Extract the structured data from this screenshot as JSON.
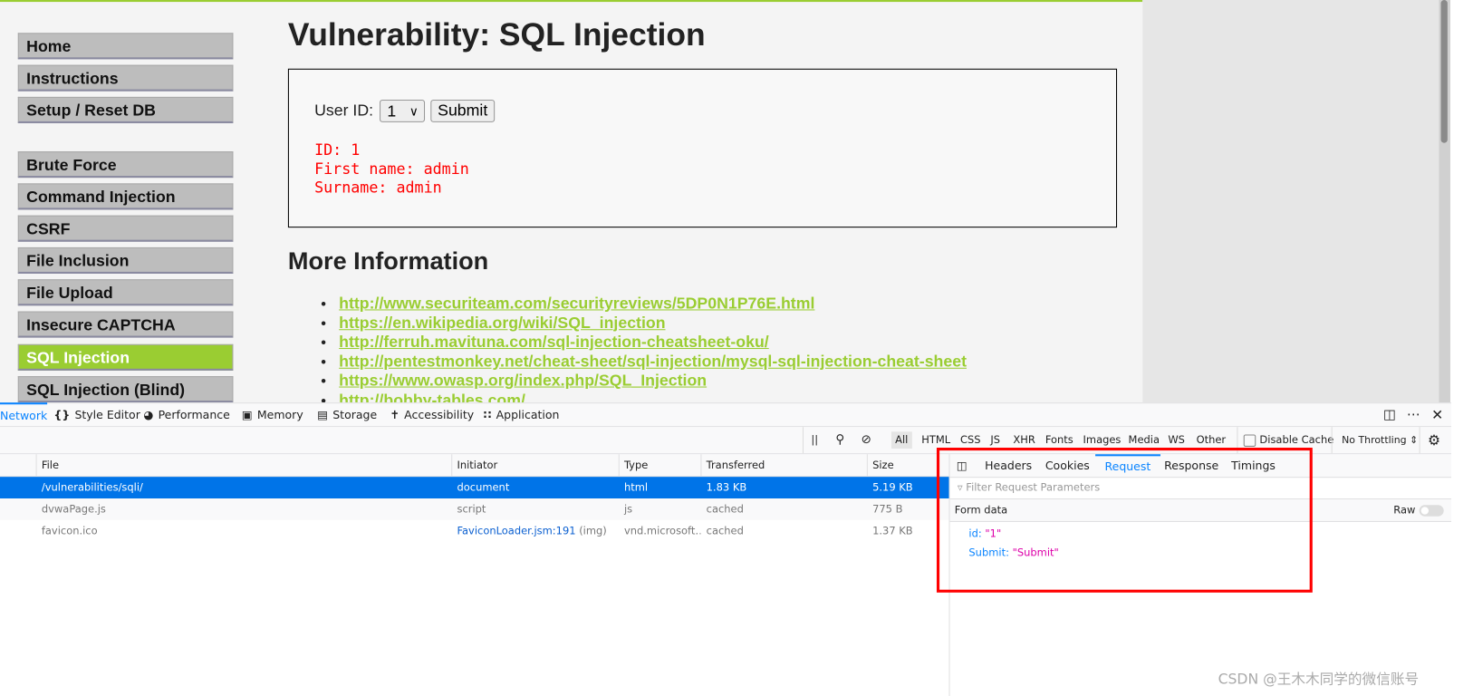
{
  "sidebar": {
    "items": [
      {
        "label": "Home"
      },
      {
        "label": "Instructions"
      },
      {
        "label": "Setup / Reset DB"
      },
      {
        "label": "Brute Force"
      },
      {
        "label": "Command Injection"
      },
      {
        "label": "CSRF"
      },
      {
        "label": "File Inclusion"
      },
      {
        "label": "File Upload"
      },
      {
        "label": "Insecure CAPTCHA"
      },
      {
        "label": "SQL Injection",
        "active": true
      },
      {
        "label": "SQL Injection (Blind)"
      }
    ]
  },
  "main": {
    "title": "Vulnerability: SQL Injection",
    "form": {
      "label": "User ID:",
      "selected": "1",
      "submit": "Submit"
    },
    "result": [
      "ID: 1",
      "First name: admin",
      "Surname: admin"
    ],
    "more_title": "More Information",
    "links": [
      "http://www.securiteam.com/securityreviews/5DP0N1P76E.html",
      "https://en.wikipedia.org/wiki/SQL_injection",
      "http://ferruh.mavituna.com/sql-injection-cheatsheet-oku/",
      "http://pentestmonkey.net/cheat-sheet/sql-injection/mysql-sql-injection-cheat-sheet",
      "https://www.owasp.org/index.php/SQL_Injection",
      "http://bobby-tables.com/"
    ]
  },
  "devtools": {
    "tabs": [
      {
        "label": "Network",
        "icon": "network"
      },
      {
        "label": "Style Editor",
        "icon": "braces"
      },
      {
        "label": "Performance",
        "icon": "gauge"
      },
      {
        "label": "Memory",
        "icon": "chip"
      },
      {
        "label": "Storage",
        "icon": "storage"
      },
      {
        "label": "Accessibility",
        "icon": "person"
      },
      {
        "label": "Application",
        "icon": "grid"
      }
    ],
    "filters": [
      "All",
      "HTML",
      "CSS",
      "JS",
      "XHR",
      "Fonts",
      "Images",
      "Media",
      "WS",
      "Other"
    ],
    "disable_cache": "Disable Cache",
    "throttling": "No Throttling",
    "columns": [
      "File",
      "Initiator",
      "Type",
      "Transferred",
      "Size"
    ],
    "rows": [
      {
        "file": "/vulnerabilities/sqli/",
        "initiator": "document",
        "type": "html",
        "transferred": "1.83 KB",
        "size": "5.19 KB"
      },
      {
        "file": "dvwaPage.js",
        "initiator": "script",
        "type": "js",
        "transferred": "cached",
        "size": "775 B"
      },
      {
        "file": "favicon.ico",
        "initiator": "FaviconLoader.jsm:191",
        "initiator_extra": "(img)",
        "type": "vnd.microsoft…",
        "transferred": "cached",
        "size": "1.37 KB"
      }
    ],
    "side_tabs": [
      "Headers",
      "Cookies",
      "Request",
      "Response",
      "Timings"
    ],
    "active_side_tab": "Request",
    "filter_placeholder": "Filter Request Parameters",
    "form_data_label": "Form data",
    "raw_label": "Raw",
    "params": [
      {
        "key": "id:",
        "value": "\"1\""
      },
      {
        "key": "Submit:",
        "value": "\"Submit\""
      }
    ]
  },
  "watermark": "CSDN @王木木同学的微信账号",
  "colors": {
    "accent": "#9acd32",
    "selection": "#0074e8",
    "highlight_box": "#ff0000"
  }
}
